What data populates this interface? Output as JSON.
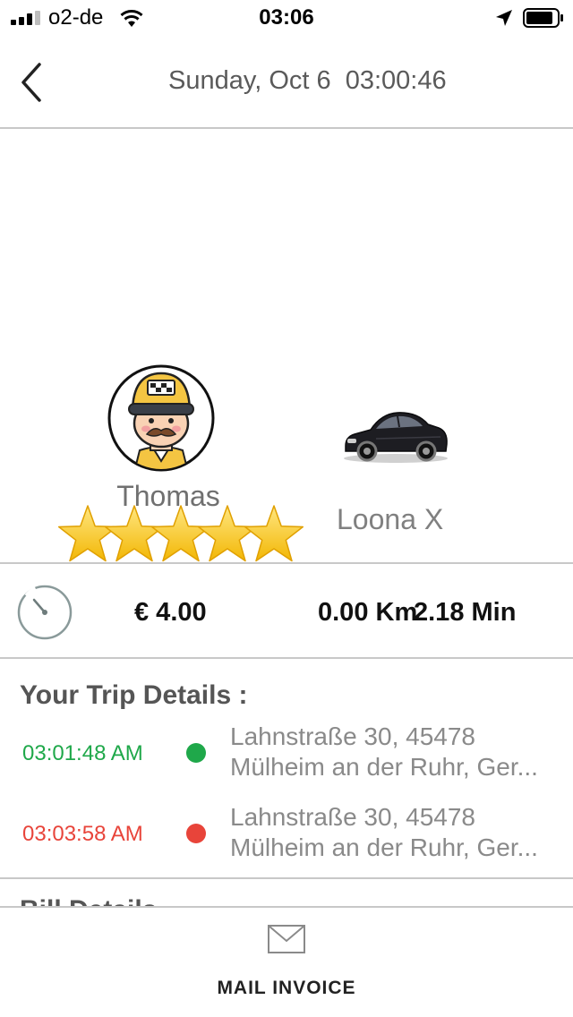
{
  "status_bar": {
    "carrier": "o2-de",
    "time": "03:06"
  },
  "header": {
    "title": "Sunday, Oct 6  03:00:46"
  },
  "driver": {
    "name": "Thomas",
    "rating": 5,
    "rating_max": 5
  },
  "vehicle": {
    "name": "Loona X"
  },
  "summary": {
    "fare": "€ 4.00",
    "distance": "0.00 Km",
    "duration": "2.18 Min"
  },
  "trip": {
    "heading": "Your Trip Details :",
    "pickup": {
      "time": "03:01:48 AM",
      "address_line1": "Lahnstraße 30, 45478",
      "address_line2": "Mülheim an der Ruhr, Ger...",
      "color": "#1fa84a"
    },
    "dropoff": {
      "time": "03:03:58 AM",
      "address_line1": "Lahnstraße 30, 45478",
      "address_line2": "Mülheim an der Ruhr, Ger...",
      "color": "#e8443a"
    }
  },
  "bill": {
    "heading": "Bill Details"
  },
  "footer": {
    "mail_invoice_label": "MAIL INVOICE"
  }
}
